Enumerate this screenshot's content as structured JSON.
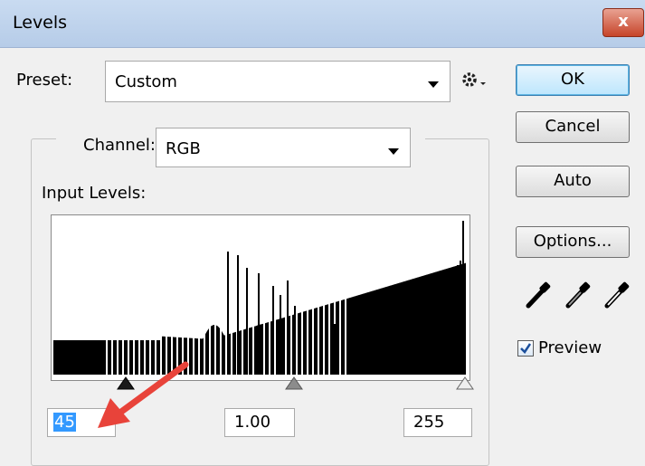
{
  "window": {
    "title": "Levels",
    "close_glyph": "x"
  },
  "preset": {
    "label": "Preset:",
    "value": "Custom"
  },
  "buttons": {
    "ok": "OK",
    "cancel": "Cancel",
    "auto": "Auto",
    "options": "Options..."
  },
  "channel": {
    "label": "Channel:",
    "value": "RGB"
  },
  "input_levels": {
    "label": "Input Levels:",
    "black": "45",
    "gamma": "1.00",
    "white": "255"
  },
  "preview": {
    "label": "Preview",
    "checked": true
  },
  "eyedroppers": [
    "black-point-eyedropper-icon",
    "gray-point-eyedropper-icon",
    "white-point-eyedropper-icon"
  ],
  "colors": {
    "selection": "#3399ff",
    "annotation_arrow": "#e8433a",
    "histogram": "#000000"
  }
}
